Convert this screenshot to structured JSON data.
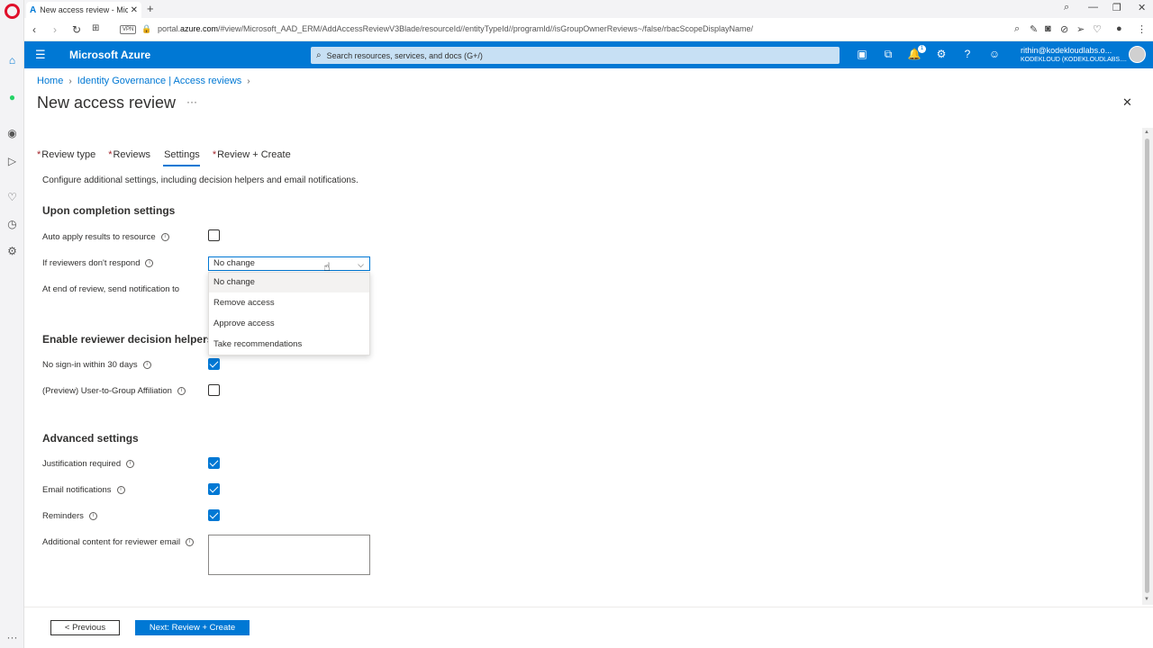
{
  "browser": {
    "tab_title": "New access review - Micros",
    "url_prefix": "portal.",
    "url_host": "azure.com",
    "url_rest": "/#view/Microsoft_AAD_ERM/AddAccessReviewV3Blade/resourceId//entityTypeId//programId//isGroupOwnerReviews~/false/rbacScopeDisplayName/",
    "vpn_label": "VPN"
  },
  "header": {
    "brand": "Microsoft Azure",
    "search_placeholder": "Search resources, services, and docs (G+/)",
    "notification_count": "1",
    "account_email": "rithin@kodekloudlabs.o...",
    "account_tenant": "KODEKLOUD (KODEKLOUDLABS...."
  },
  "breadcrumb": {
    "home": "Home",
    "parent": "Identity Governance | Access reviews"
  },
  "page": {
    "title": "New access review",
    "more": "···"
  },
  "tabs": [
    {
      "label": "Review type",
      "required": "*"
    },
    {
      "label": "Reviews",
      "required": "*"
    },
    {
      "label": "Settings",
      "required": ""
    },
    {
      "label": "Review + Create",
      "required": "*"
    }
  ],
  "description": "Configure additional settings, including decision helpers and email notifications.",
  "completion": {
    "title": "Upon completion settings",
    "auto_apply_label": "Auto apply results to resource",
    "auto_apply": false,
    "no_response_label": "If reviewers don't respond",
    "no_response_value": "No change",
    "notify_label": "At end of review, send notification to",
    "options": [
      "No change",
      "Remove access",
      "Approve access",
      "Take recommendations"
    ]
  },
  "helpers": {
    "title": "Enable reviewer decision helpers",
    "no_signin_label": "No sign-in within 30 days",
    "no_signin": true,
    "affiliation_label": "(Preview) User-to-Group Affiliation",
    "affiliation": false
  },
  "advanced": {
    "title": "Advanced settings",
    "justification_label": "Justification required",
    "justification": true,
    "email_label": "Email notifications",
    "email": true,
    "reminders_label": "Reminders",
    "reminders": true,
    "additional_label": "Additional content for reviewer email",
    "additional_value": ""
  },
  "footer": {
    "previous": "< Previous",
    "next": "Next: Review + Create"
  },
  "colors": {
    "azure_blue": "#0078d4",
    "opera_red": "#e0102b"
  }
}
